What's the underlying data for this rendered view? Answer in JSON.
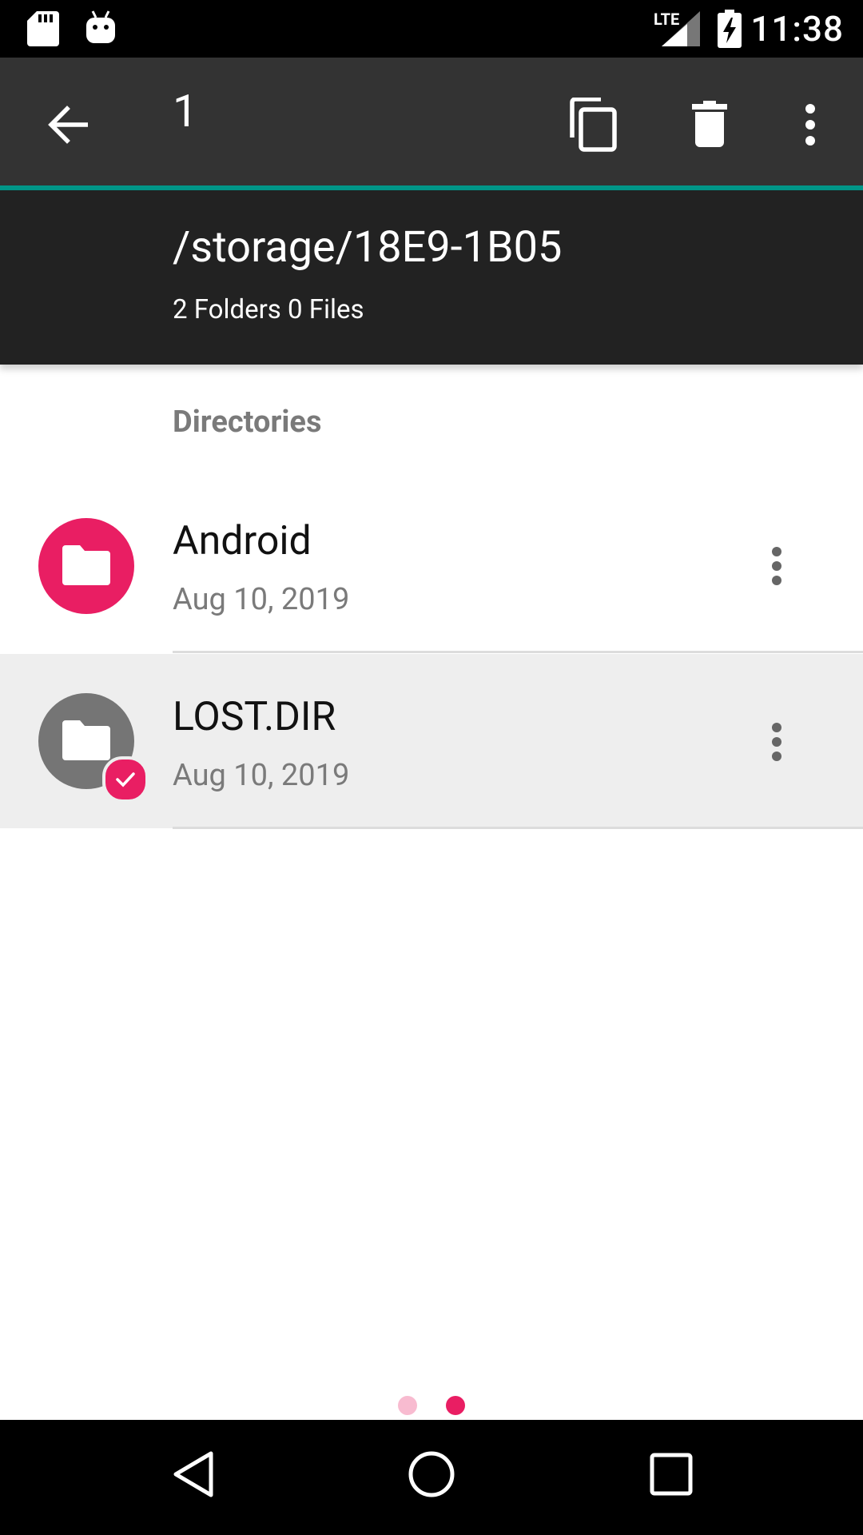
{
  "status_bar": {
    "time": "11:38",
    "network_label": "LTE",
    "icons": [
      "sd-card-icon",
      "android-debug-icon",
      "signal-icon",
      "battery-charging-icon"
    ]
  },
  "action_bar": {
    "selected_count": "1",
    "actions": [
      "back-arrow-icon",
      "copy-icon",
      "delete-icon",
      "more-vert-icon"
    ]
  },
  "path_header": {
    "path": "/storage/18E9-1B05",
    "summary": "2 Folders 0 Files"
  },
  "list": {
    "section_label": "Directories",
    "items": [
      {
        "name": "Android",
        "date": "Aug 10, 2019",
        "selected": false
      },
      {
        "name": "LOST.DIR",
        "date": "Aug 10, 2019",
        "selected": true
      }
    ]
  },
  "page_indicator": {
    "count": 2,
    "active_index": 1
  },
  "colors": {
    "accent": "#E91E63",
    "teal": "#009688",
    "toolbar": "#333333",
    "header": "#222222",
    "selected_row": "#EEEEEE"
  }
}
